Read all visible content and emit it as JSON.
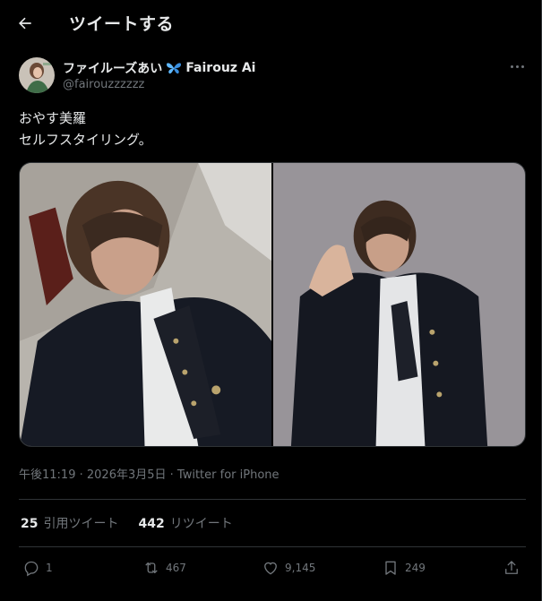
{
  "header": {
    "title": "ツイートする"
  },
  "author": {
    "display_name": "ファイルーズあい",
    "display_name_en": "Fairouz Ai",
    "handle": "@fairouzzzzzz"
  },
  "tweet": {
    "lines": [
      "おやす美羅",
      "セルフスタイリング。"
    ]
  },
  "meta": {
    "time": "午後11:19",
    "date": "2026年3月5日",
    "source": "Twitter for iPhone"
  },
  "stats": {
    "quote_count": "25",
    "quote_label": "引用ツイート",
    "retweet_count": "442",
    "retweet_label": "リツイート"
  },
  "actions": {
    "reply": "1",
    "retweet": "467",
    "like": "9,145",
    "bookmark": "249"
  },
  "colors": {
    "background": "#000000",
    "text_primary": "#e7e9ea",
    "text_secondary": "#71767b",
    "divider": "#2f3336",
    "butterfly": "#5fb8ff"
  },
  "icons": [
    "back-arrow-icon",
    "butterfly-icon",
    "more-icon",
    "reply-icon",
    "retweet-icon",
    "like-icon",
    "bookmark-icon",
    "share-icon"
  ]
}
